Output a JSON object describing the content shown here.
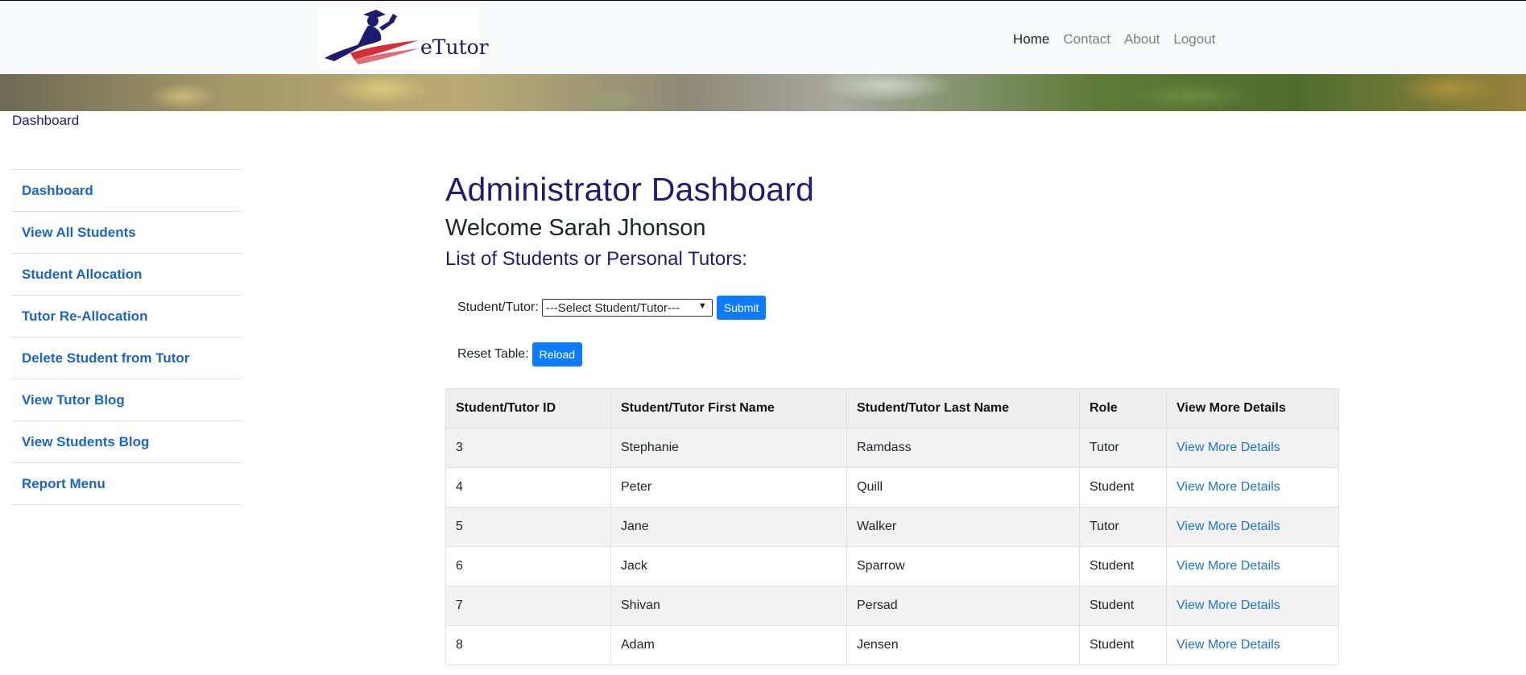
{
  "header": {
    "logo_text": "eTutor",
    "nav": [
      {
        "label": "Home"
      },
      {
        "label": "Contact"
      },
      {
        "label": "About"
      },
      {
        "label": "Logout"
      }
    ]
  },
  "breadcrumb": "Dashboard",
  "sidebar": {
    "items": [
      {
        "label": "Dashboard"
      },
      {
        "label": "View All Students"
      },
      {
        "label": "Student Allocation"
      },
      {
        "label": "Tutor Re-Allocation"
      },
      {
        "label": "Delete Student from Tutor"
      },
      {
        "label": "View Tutor Blog"
      },
      {
        "label": "View Students Blog"
      },
      {
        "label": "Report Menu"
      }
    ]
  },
  "main": {
    "title": "Administrator Dashboard",
    "welcome": "Welcome Sarah Jhonson",
    "subtitle": "List of Students or Personal Tutors:",
    "filter": {
      "label": "Student/Tutor:",
      "selected": "---Select Student/Tutor---",
      "submit": "Submit"
    },
    "reset": {
      "label": "Reset Table:",
      "button": "Reload"
    },
    "table": {
      "headers": [
        "Student/Tutor ID",
        "Student/Tutor First Name",
        "Student/Tutor Last Name",
        "Role",
        "View More Details"
      ],
      "rows": [
        {
          "id": "3",
          "first": "Stephanie",
          "last": "Ramdass",
          "role": "Tutor",
          "link": "View More Details"
        },
        {
          "id": "4",
          "first": "Peter",
          "last": "Quill",
          "role": "Student",
          "link": "View More Details"
        },
        {
          "id": "5",
          "first": "Jane",
          "last": "Walker",
          "role": "Tutor",
          "link": "View More Details"
        },
        {
          "id": "6",
          "first": "Jack",
          "last": "Sparrow",
          "role": "Student",
          "link": "View More Details"
        },
        {
          "id": "7",
          "first": "Shivan",
          "last": "Persad",
          "role": "Student",
          "link": "View More Details"
        },
        {
          "id": "8",
          "first": "Adam",
          "last": "Jensen",
          "role": "Student",
          "link": "View More Details"
        }
      ]
    }
  },
  "colors": {
    "brand": "#221c6e",
    "link": "#1a66c6",
    "button": "#0d7bff"
  }
}
